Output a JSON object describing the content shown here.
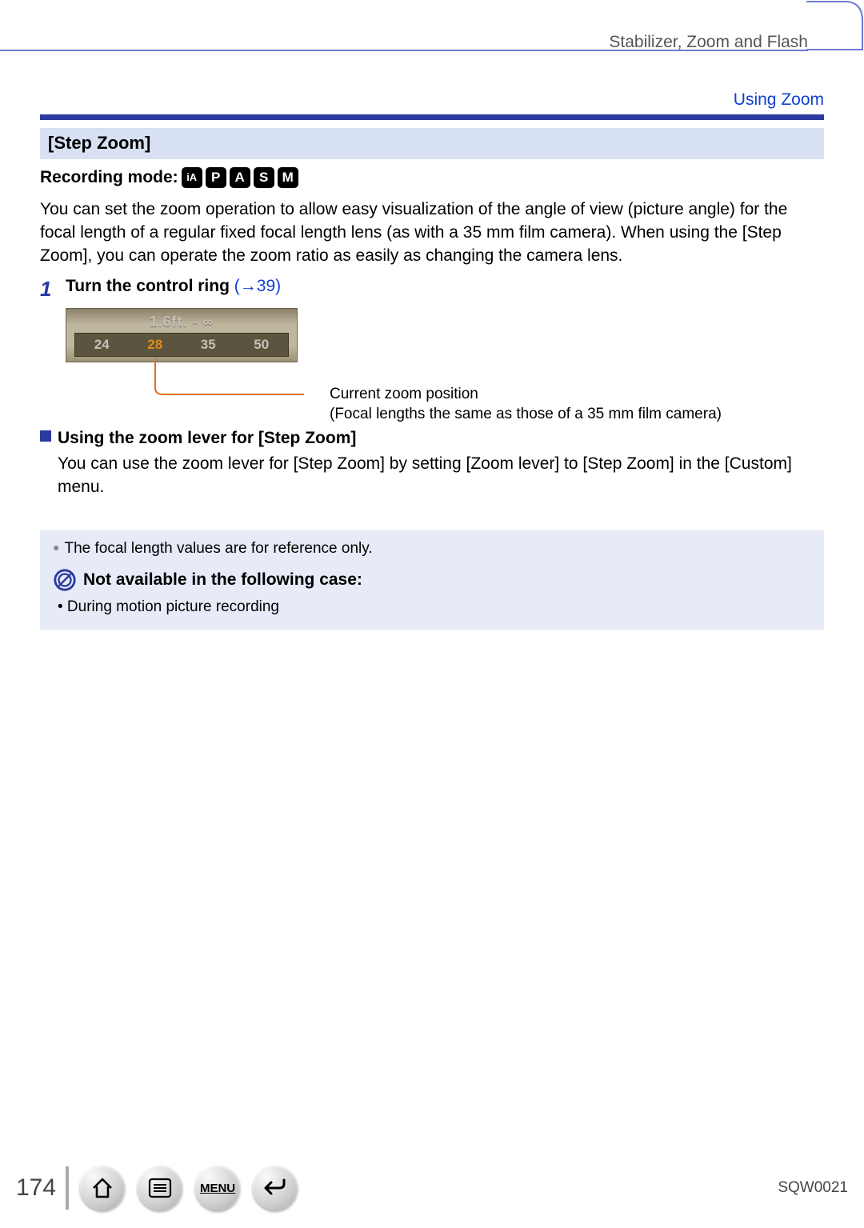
{
  "header": {
    "chapter": "Stabilizer, Zoom and Flash"
  },
  "section_link": "Using Zoom",
  "subheading": "[Step Zoom]",
  "recording_mode_label": "Recording mode:",
  "mode_icons": [
    "iA",
    "P",
    "A",
    "S",
    "M"
  ],
  "description": "You can set the zoom operation to allow easy visualization of the angle of view (picture angle) for the focal length of a regular fixed focal length lens (as with a 35 mm film camera). When using the [Step Zoom], you can operate the zoom ratio as easily as changing the camera lens.",
  "step": {
    "num": "1",
    "text": "Turn the control ring ",
    "xref": "(→39)"
  },
  "lcd": {
    "distance": "1.6ft. - ∞",
    "values": [
      "24",
      "28",
      "35",
      "50"
    ],
    "active_index": 1
  },
  "caption_line1": "Current zoom position",
  "caption_line2": "(Focal lengths the same as those of a 35 mm film camera)",
  "sub2_title": "Using the zoom lever for [Step Zoom]",
  "sub2_para": "You can use the zoom lever for [Step Zoom] by setting [Zoom lever] to [Step Zoom] in the [Custom] menu.",
  "notice": {
    "line1": "The focal length values are for reference only.",
    "na_title": "Not available in the following case:",
    "na_item": "• During motion picture recording"
  },
  "footer": {
    "page": "174",
    "menu_label": "MENU",
    "doc_id": "SQW0021"
  }
}
